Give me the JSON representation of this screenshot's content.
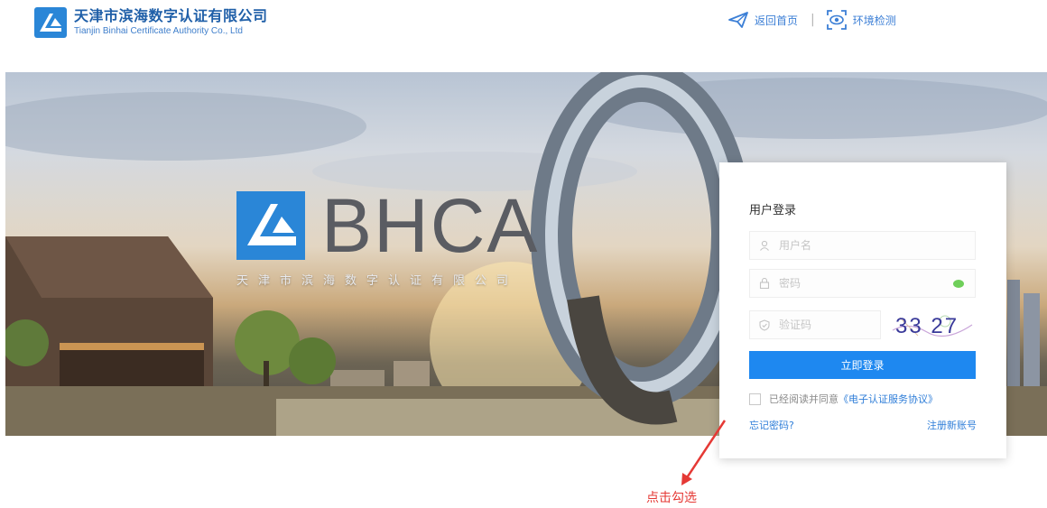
{
  "header": {
    "company_cn": "天津市滨海数字认证有限公司",
    "company_en": "Tianjin Binhai Certificate Authority Co., Ltd",
    "nav": {
      "home_label": "返回首页",
      "separator": "|",
      "env_check_label": "环境检测"
    }
  },
  "banner": {
    "brand_name": "BHCA",
    "brand_subtitle": "天津市滨海数字认证有限公司"
  },
  "login": {
    "title": "用户登录",
    "username_placeholder": "用户名",
    "password_placeholder": "密码",
    "captcha_placeholder": "验证码",
    "captcha_value": "33 27",
    "submit_label": "立即登录",
    "agree_text": "已经阅读并同意",
    "agree_link": "《电子认证服务协议》",
    "agree_checked": false,
    "forgot_label": "忘记密码?",
    "register_label": "注册新账号"
  },
  "annotation": {
    "callout_text": "点击勾选",
    "color": "#e53935"
  },
  "colors": {
    "brand_blue": "#1f5fa8",
    "button_blue": "#1e88f0",
    "link_blue": "#2f7ed8"
  },
  "icons": {
    "home": "paper-plane-icon",
    "env": "eye-scan-icon",
    "user": "user-icon",
    "lock": "lock-icon",
    "shield": "shield-icon",
    "eye": "eye-toggle-icon"
  }
}
